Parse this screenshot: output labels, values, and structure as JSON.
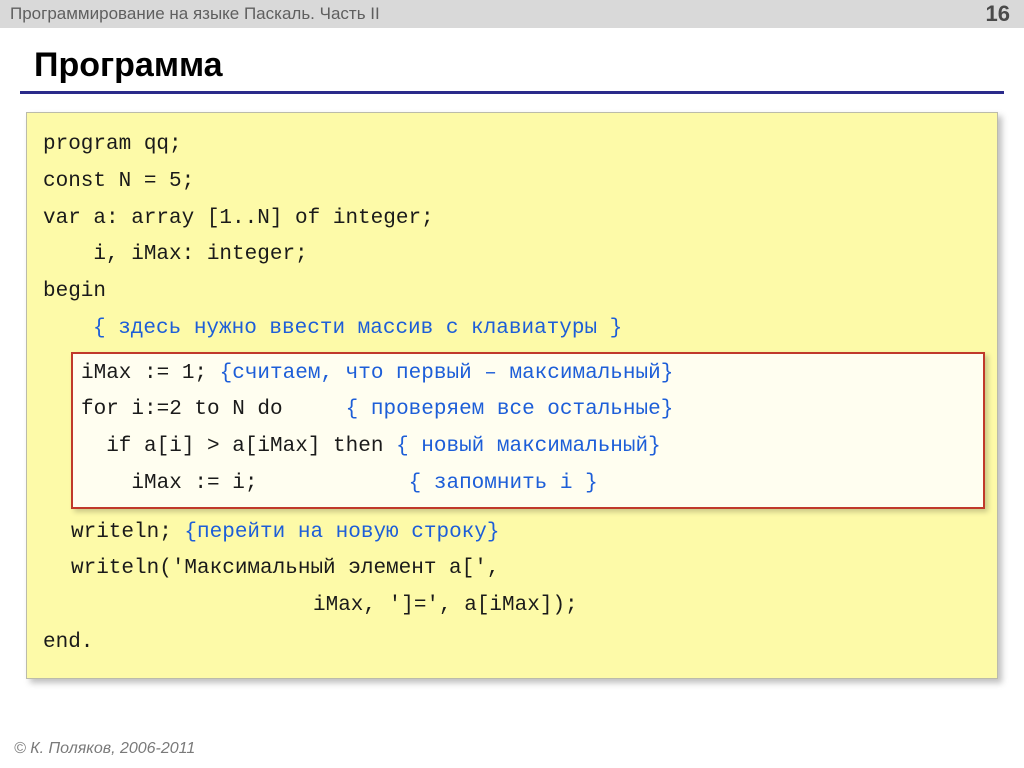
{
  "header": {
    "title": "Программирование на языке Паскаль. Часть II",
    "page": "16"
  },
  "slide_title": "Программа",
  "code": {
    "l1": "program qq;",
    "l2": "const N = 5;",
    "l3": "var a: array [1..N] of integer;",
    "l4": "    i, iMax: integer;",
    "l5": "begin",
    "l6_cm": "{ здесь нужно ввести массив с клавиатуры }",
    "box": {
      "b1_code": "iMax := 1; ",
      "b1_cm": "{считаем, что первый – максимальный}",
      "b2_code": "for i:=2 to N do     ",
      "b2_cm": "{ проверяем все остальные}",
      "b3_code": "  if a[i] > a[iMax] then ",
      "b3_cm": "{ новый максимальный}",
      "b4_code": "    iMax := i;            ",
      "b4_cm": "{ запомнить i }"
    },
    "l7_code": "writeln; ",
    "l7_cm": "{перейти на новую строку}",
    "l8": "writeln('Максимальный элемент a[',",
    "l9": "iMax, ']=', a[iMax]);",
    "l10": "end."
  },
  "footer": "© К. Поляков, 2006-2011"
}
